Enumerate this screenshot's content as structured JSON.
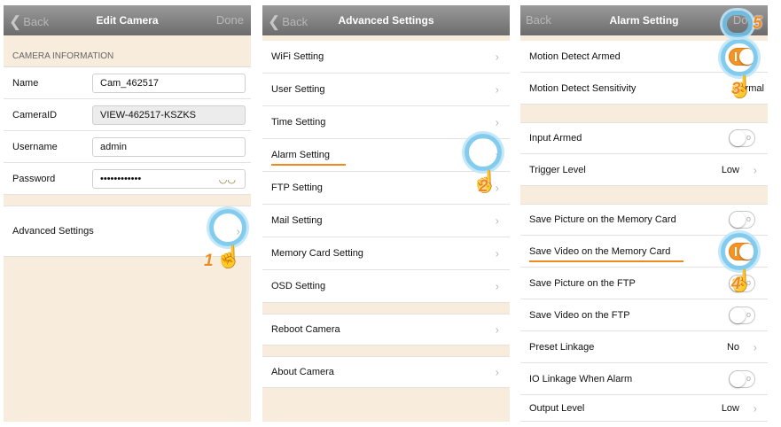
{
  "edit_camera": {
    "back": "Back",
    "title": "Edit Camera",
    "done": "Done",
    "section": "CAMERA INFORMATION",
    "fields": [
      {
        "label": "Name",
        "value": "Cam_462517"
      },
      {
        "label": "CameraID",
        "value": "VIEW-462517-KSZKS"
      },
      {
        "label": "Username",
        "value": "admin"
      },
      {
        "label": "Password",
        "value": "••••••••••••"
      }
    ],
    "advanced": "Advanced Settings",
    "step": "1"
  },
  "advanced_settings": {
    "back": "Back",
    "title": "Advanced Settings",
    "items": [
      "WiFi Setting",
      "User Setting",
      "Time Setting",
      "Alarm Setting",
      "FTP Setting",
      "Mail Setting",
      "Memory Card Setting",
      "OSD Setting"
    ],
    "reboot": "Reboot Camera",
    "about": "About Camera",
    "step": "2"
  },
  "alarm_setting": {
    "back": "Back",
    "title": "Alarm Setting",
    "done": "Done",
    "rows": [
      {
        "label": "Motion Detect Armed",
        "toggle": true
      },
      {
        "label": "Motion Detect Sensitivity",
        "value": "Normal"
      },
      {
        "label": "Input Armed",
        "toggle": false
      },
      {
        "label": "Trigger Level",
        "value": "Low"
      },
      {
        "label": "Save Picture on the Memory Card",
        "toggle": false
      },
      {
        "label": "Save Video on the Memory Card",
        "toggle": true
      },
      {
        "label": "Save Picture on the FTP",
        "toggle": false
      },
      {
        "label": "Save Video on the FTP",
        "toggle": false
      },
      {
        "label": "Preset Linkage",
        "value": "No"
      },
      {
        "label": "IO Linkage When Alarm",
        "toggle": false
      },
      {
        "label": "Output Level",
        "value": "Low"
      }
    ],
    "steps": [
      "3",
      "4",
      "5"
    ]
  },
  "icons": {
    "chevron": "chevron-right-icon",
    "back": "chevron-left-icon",
    "eye": "eye-icon",
    "hand": "pointing-hand-icon"
  },
  "colors": {
    "accent": "#f08a1e",
    "highlight_ring": "#6ec3eb",
    "toggle_on": "#f39425"
  }
}
